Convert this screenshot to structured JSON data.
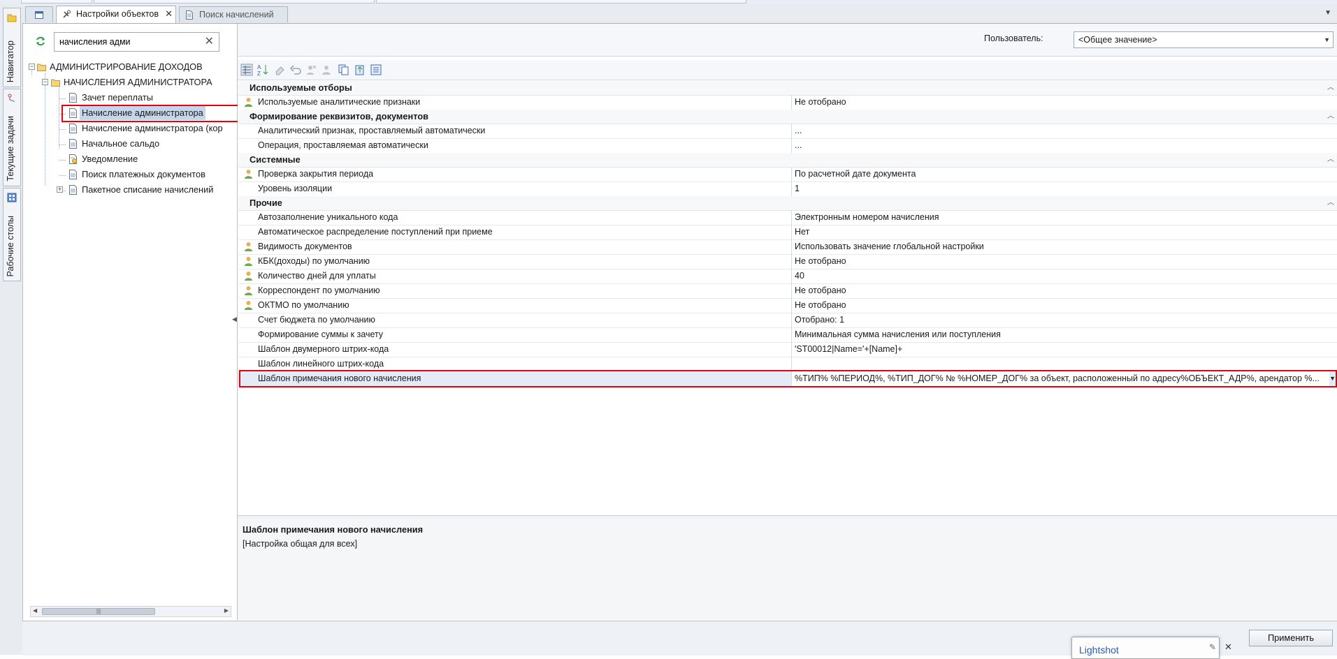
{
  "tabs": [
    {
      "label": ""
    },
    {
      "label": "Настройки объектов",
      "close": "✕"
    },
    {
      "label": "Поиск начислений"
    }
  ],
  "rail": {
    "navigator": "Навигатор",
    "tasks": "Текущие задачи",
    "desktops": "Рабочие столы"
  },
  "navigator": {
    "search_value": "начисления адми",
    "clear_symbol": "✕",
    "tree": [
      {
        "label": "АДМИНИСТРИРОВАНИЕ ДОХОДОВ"
      },
      {
        "label": "НАЧИСЛЕНИЯ АДМИНИСТРАТОРА"
      },
      {
        "label": "Зачет переплаты"
      },
      {
        "label": "Начисление администратора"
      },
      {
        "label": "Начисление администратора (кор"
      },
      {
        "label": "Начальное сальдо"
      },
      {
        "label": "Уведомление"
      },
      {
        "label": "Поиск платежных документов"
      },
      {
        "label": "Пакетное списание начислений"
      }
    ]
  },
  "user_bar": {
    "label": "Пользователь:",
    "value": "<Общее значение>"
  },
  "groups": [
    {
      "label": "Используемые отборы"
    },
    {
      "label": "Формирование реквизитов, документов"
    },
    {
      "label": "Системные"
    },
    {
      "label": "Прочие"
    }
  ],
  "properties": [
    {
      "name": "Используемые аналитические признаки",
      "value": "Не отобрано"
    },
    {
      "name": "Аналитический признак, проставляемый автоматически",
      "value": "..."
    },
    {
      "name": "Операция, проставляемая автоматически",
      "value": "..."
    },
    {
      "name": "Проверка закрытия периода",
      "value": "По расчетной дате документа"
    },
    {
      "name": "Уровень изоляции",
      "value": "1"
    },
    {
      "name": "Автозаполнение уникального кода",
      "value": "Электронным номером начисления"
    },
    {
      "name": "Автоматическое распределение поступлений при приеме",
      "value": "Нет"
    },
    {
      "name": "Видимость документов",
      "value": "Использовать значение глобальной настройки"
    },
    {
      "name": "КБК(доходы) по умолчанию",
      "value": "Не отобрано"
    },
    {
      "name": "Количество дней для уплаты",
      "value": "40"
    },
    {
      "name": "Корреспондент по умолчанию",
      "value": "Не отобрано"
    },
    {
      "name": "ОКТМО по умолчанию",
      "value": "Не отобрано"
    },
    {
      "name": "Счет бюджета по умолчанию",
      "value": "Отобрано: 1"
    },
    {
      "name": "Формирование суммы к зачету",
      "value": "Минимальная сумма начисления или поступления"
    },
    {
      "name": "Шаблон двумерного штрих-кода",
      "value": "'ST00012|Name='+[Name]+"
    },
    {
      "name": "Шаблон линейного штрих-кода",
      "value": ""
    },
    {
      "name": "Шаблон примечания нового начисления",
      "value": "%ТИП% %ПЕРИОД%, %ТИП_ДОГ% № %НОМЕР_ДОГ% за объект, расположенный по адресу%ОБЪЕКТ_АДР%, арендатор %..."
    }
  ],
  "description": {
    "title": "Шаблон примечания нового начисления",
    "text": "[Настройка общая для всех]"
  },
  "apply_label": "Применить",
  "lightshot": {
    "title": "Lightshot",
    "close": "✕"
  },
  "colors": {
    "highlight_red": "#e8000d",
    "selection": "#c6d6ea",
    "link_blue": "#2a5db0"
  }
}
